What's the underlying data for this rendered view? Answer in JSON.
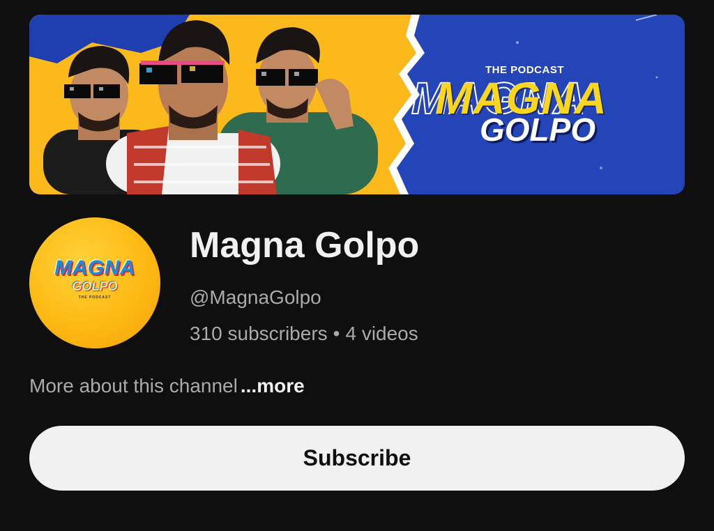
{
  "banner": {
    "tagline": "THE PODCAST",
    "title_primary": "MAGNA",
    "title_secondary": "GOLPO",
    "colors": {
      "yellow": "#fbb91c",
      "blue": "#1f3fb0",
      "white": "#ffffff"
    }
  },
  "avatar": {
    "logo_primary": "MAGNA",
    "logo_secondary": "GOLPO",
    "logo_tagline": "THE PODCAST",
    "background_color": "#fdb913"
  },
  "channel": {
    "name": "Magna Golpo",
    "handle": "@MagnaGolpo",
    "subscribers": "310 subscribers",
    "separator": "•",
    "videos": "4 videos"
  },
  "about": {
    "text": "More about this channel",
    "more_label": "...more"
  },
  "subscribe": {
    "label": "Subscribe"
  },
  "theme": {
    "background": "#0f0f0f",
    "primary_text": "#f1f1f1",
    "secondary_text": "#aaaaaa"
  }
}
